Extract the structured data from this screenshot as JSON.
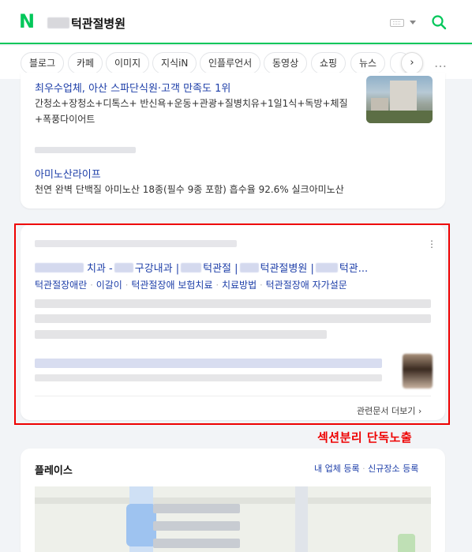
{
  "header": {
    "logo": "N",
    "query_visible": "턱관절병원"
  },
  "tabs": [
    {
      "label": "블로그"
    },
    {
      "label": "카페"
    },
    {
      "label": "이미지"
    },
    {
      "label": "지식iN"
    },
    {
      "label": "인플루언서"
    },
    {
      "label": "동영상"
    },
    {
      "label": "쇼핑"
    },
    {
      "label": "뉴스"
    },
    {
      "label": "…"
    }
  ],
  "card1": {
    "item1_title": "최우수업체, 아산 스파단식원·고객 만족도 1위",
    "item1_snippet": "간청소+장청소+디톡스+ 반신욕+운동+관광+질병치유+1일1식+독방+체질+폭풍다이어트",
    "item2_title": "아미노산라이프",
    "item2_snippet": "천연 완벽 단백질 아미노산 18종(필수 9종 포함) 흡수율 92.6% 실크아미노산"
  },
  "card2": {
    "title_parts": [
      "치과 - ",
      "구강내과 | ",
      "턱관절 | ",
      "턱관절병원 | ",
      "턱관..."
    ],
    "sublinks": [
      "턱관절장애란",
      "이갈이",
      "턱관절장애 보험치료",
      "치료방법",
      "턱관절장애 자가설문"
    ],
    "related_docs": "관련문서 더보기",
    "more_icon": "⋮"
  },
  "annotation": {
    "label": "섹션분리 단독노출",
    "color": "#e00000"
  },
  "card3": {
    "title": "플레이스",
    "link_register": "내 업체 등록",
    "link_new_place": "신규장소 등록"
  },
  "colors": {
    "brand_green": "#03c75a",
    "link_blue": "#1d3ea8"
  }
}
